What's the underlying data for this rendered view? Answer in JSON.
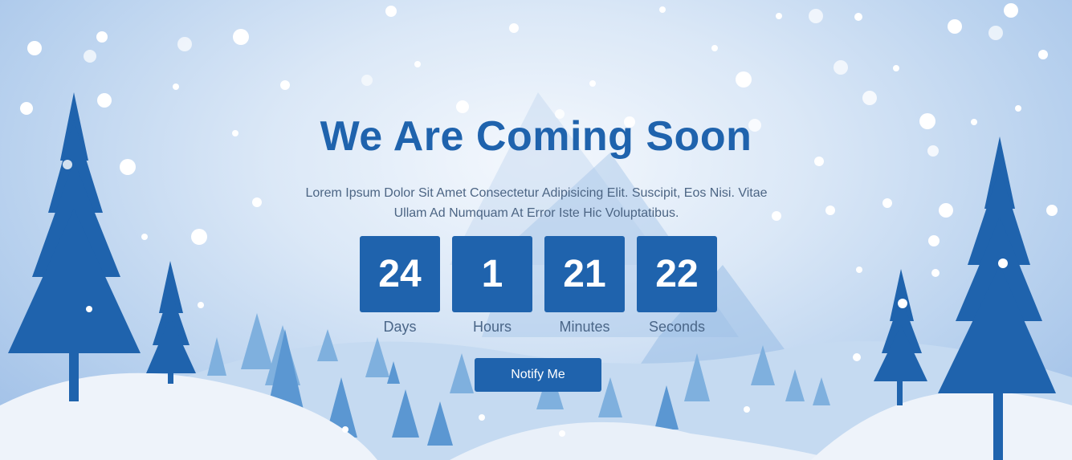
{
  "hero": {
    "title": "We Are Coming Soon",
    "description": "Lorem Ipsum Dolor Sit Amet Consectetur Adipisicing Elit. Suscipit, Eos Nisi. Vitae Ullam Ad Numquam At Error Iste Hic Voluptatibus."
  },
  "countdown": [
    {
      "value": "24",
      "label": "Days"
    },
    {
      "value": "1",
      "label": "Hours"
    },
    {
      "value": "21",
      "label": "Minutes"
    },
    {
      "value": "22",
      "label": "Seconds"
    }
  ],
  "notify_button": {
    "label": "Notify Me"
  },
  "colors": {
    "accent": "#1f63ad",
    "tree_dark": "#1f63ad",
    "tree_light": "#6ea6d9",
    "snow_ground": "#eef3fa"
  },
  "decoration": {
    "scene": "snowy-winter-landscape",
    "icons": [
      "pine-tree-icon",
      "snowflake-icon",
      "mountain-icon"
    ]
  }
}
